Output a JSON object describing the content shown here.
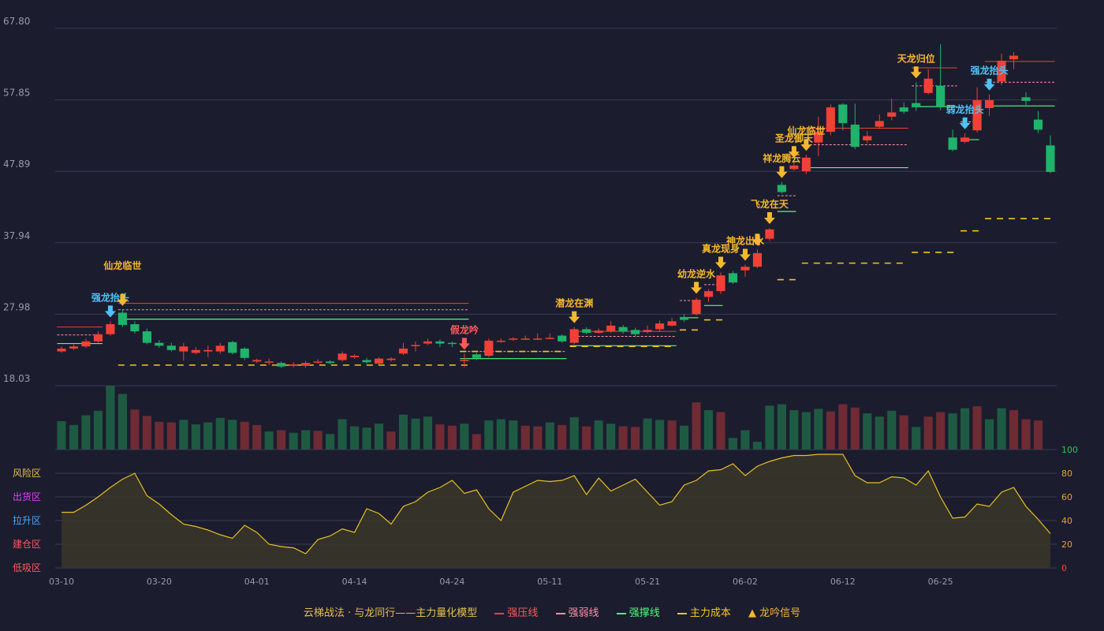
{
  "chart_data": {
    "type": "candlestick",
    "price_axis": {
      "ticks": [
        "67.80",
        "57.85",
        "47.89",
        "37.94",
        "27.98",
        "18.03"
      ],
      "min": 18.03,
      "max": 67.8
    },
    "x_tick_labels": [
      {
        "index": 0,
        "label": "03-10"
      },
      {
        "index": 8,
        "label": "03-20"
      },
      {
        "index": 16,
        "label": "04-01"
      },
      {
        "index": 24,
        "label": "04-14"
      },
      {
        "index": 32,
        "label": "04-24"
      },
      {
        "index": 40,
        "label": "05-11"
      },
      {
        "index": 48,
        "label": "05-21"
      },
      {
        "index": 56,
        "label": "06-02"
      },
      {
        "index": 64,
        "label": "06-12"
      },
      {
        "index": 72,
        "label": "06-25"
      }
    ],
    "candles": [
      [
        22.8,
        23.2,
        23.5,
        22.6
      ],
      [
        23.2,
        23.5,
        23.8,
        23.0
      ],
      [
        23.5,
        24.2,
        24.6,
        23.3
      ],
      [
        24.2,
        25.2,
        25.6,
        24.0
      ],
      [
        25.2,
        26.6,
        27.0,
        25.0
      ],
      [
        28.2,
        26.5,
        28.6,
        26.2
      ],
      [
        26.6,
        25.6,
        27.0,
        25.3
      ],
      [
        25.6,
        24.0,
        26.0,
        23.8
      ],
      [
        24.0,
        23.6,
        24.4,
        23.3
      ],
      [
        23.6,
        23.0,
        24.0,
        22.8
      ],
      [
        22.8,
        23.5,
        24.0,
        21.5
      ],
      [
        22.6,
        23.0,
        23.4,
        22.4
      ],
      [
        22.8,
        23.0,
        23.6,
        22.0
      ],
      [
        22.8,
        23.6,
        24.0,
        22.5
      ],
      [
        24.1,
        22.6,
        24.3,
        22.4
      ],
      [
        23.2,
        21.9,
        23.4,
        21.6
      ],
      [
        21.4,
        21.6,
        21.8,
        21.2
      ],
      [
        21.3,
        21.4,
        21.8,
        20.9
      ],
      [
        21.2,
        20.7,
        21.4,
        20.5
      ],
      [
        20.8,
        21.0,
        21.3,
        20.6
      ],
      [
        20.8,
        21.2,
        21.5,
        20.5
      ],
      [
        21.3,
        21.4,
        21.7,
        21.1
      ],
      [
        21.4,
        21.2,
        21.6,
        21.0
      ],
      [
        21.6,
        22.5,
        22.8,
        21.4
      ],
      [
        22.0,
        22.2,
        22.4,
        21.8
      ],
      [
        21.6,
        21.3,
        21.9,
        21.1
      ],
      [
        21.1,
        21.8,
        22.0,
        21.0
      ],
      [
        21.6,
        21.8,
        22.0,
        21.4
      ],
      [
        22.5,
        23.2,
        24.0,
        22.3
      ],
      [
        23.6,
        23.7,
        24.2,
        22.8
      ],
      [
        23.9,
        24.2,
        24.6,
        23.7
      ],
      [
        24.2,
        23.9,
        24.5,
        23.4
      ],
      [
        24.0,
        23.9,
        24.2,
        23.4
      ],
      [
        21.5,
        21.6,
        22.5,
        20.6
      ],
      [
        22.4,
        21.9,
        22.6,
        21.6
      ],
      [
        22.2,
        24.3,
        24.6,
        22.0
      ],
      [
        24.2,
        24.3,
        24.6,
        24.0
      ],
      [
        24.5,
        24.6,
        24.8,
        24.3
      ],
      [
        24.6,
        24.6,
        25.0,
        24.4
      ],
      [
        24.6,
        24.6,
        25.3,
        24.4
      ],
      [
        24.7,
        24.7,
        25.3,
        24.5
      ],
      [
        25.0,
        24.2,
        25.2,
        24.0
      ],
      [
        24.0,
        25.9,
        26.2,
        23.8
      ],
      [
        25.9,
        25.4,
        26.2,
        25.2
      ],
      [
        25.4,
        25.7,
        26.0,
        25.3
      ],
      [
        25.6,
        26.4,
        27.0,
        25.4
      ],
      [
        26.2,
        25.6,
        26.5,
        25.3
      ],
      [
        25.8,
        25.2,
        26.1,
        24.8
      ],
      [
        25.5,
        25.8,
        26.4,
        25.3
      ],
      [
        25.9,
        26.7,
        27.1,
        25.5
      ],
      [
        26.4,
        27.0,
        27.5,
        26.3
      ],
      [
        27.6,
        27.2,
        28.0,
        26.9
      ],
      [
        28.0,
        30.0,
        30.3,
        27.8
      ],
      [
        30.4,
        31.2,
        31.5,
        29.7
      ],
      [
        31.2,
        33.4,
        33.8,
        30.8
      ],
      [
        33.7,
        32.4,
        34.0,
        32.2
      ],
      [
        34.1,
        34.6,
        34.9,
        33.2
      ],
      [
        34.6,
        36.5,
        37.0,
        34.4
      ],
      [
        38.5,
        39.8,
        40.0,
        38.2
      ],
      [
        46.0,
        45.0,
        46.4,
        44.8
      ],
      [
        48.2,
        48.7,
        49.2,
        48.0
      ],
      [
        47.9,
        49.8,
        50.2,
        47.5
      ],
      [
        51.9,
        53.4,
        55.5,
        50.0
      ],
      [
        53.4,
        56.8,
        57.2,
        52.9
      ],
      [
        57.2,
        54.6,
        57.4,
        53.6
      ],
      [
        54.4,
        51.3,
        57.3,
        51.0
      ],
      [
        52.2,
        52.8,
        53.5,
        51.8
      ],
      [
        54.1,
        54.9,
        55.8,
        53.8
      ],
      [
        55.5,
        56.1,
        58.0,
        55.0
      ],
      [
        56.8,
        56.2,
        57.5,
        55.9
      ],
      [
        57.4,
        56.8,
        60.3,
        56.3
      ],
      [
        58.8,
        60.8,
        62.1,
        58.6
      ],
      [
        59.8,
        56.9,
        65.6,
        56.4
      ],
      [
        52.6,
        50.9,
        53.7,
        50.7
      ],
      [
        52.0,
        52.6,
        53.2,
        51.8
      ],
      [
        53.6,
        57.8,
        59.6,
        53.3
      ],
      [
        56.7,
        57.8,
        58.6,
        55.6
      ],
      [
        60.4,
        63.3,
        64.3,
        59.9
      ],
      [
        63.5,
        64.0,
        64.5,
        62.1
      ],
      [
        58.2,
        57.7,
        58.9,
        56.9
      ],
      [
        55.1,
        53.7,
        56.3,
        53.2
      ],
      [
        51.5,
        47.8,
        52.9,
        47.6
      ]
    ],
    "volume": [
      [
        44,
        1
      ],
      [
        38,
        1
      ],
      [
        53,
        1
      ],
      [
        60,
        1
      ],
      [
        99,
        1
      ],
      [
        86,
        1
      ],
      [
        62,
        0
      ],
      [
        52,
        0
      ],
      [
        43,
        0
      ],
      [
        42,
        0
      ],
      [
        46,
        1
      ],
      [
        39,
        1
      ],
      [
        42,
        1
      ],
      [
        49,
        1
      ],
      [
        46,
        1
      ],
      [
        43,
        0
      ],
      [
        38,
        0
      ],
      [
        28,
        1
      ],
      [
        30,
        0
      ],
      [
        26,
        1
      ],
      [
        30,
        1
      ],
      [
        29,
        0
      ],
      [
        24,
        1
      ],
      [
        47,
        1
      ],
      [
        36,
        1
      ],
      [
        34,
        1
      ],
      [
        40,
        1
      ],
      [
        28,
        0
      ],
      [
        54,
        1
      ],
      [
        48,
        1
      ],
      [
        51,
        1
      ],
      [
        39,
        0
      ],
      [
        37,
        0
      ],
      [
        40,
        1
      ],
      [
        24,
        0
      ],
      [
        45,
        1
      ],
      [
        47,
        1
      ],
      [
        45,
        1
      ],
      [
        37,
        0
      ],
      [
        36,
        0
      ],
      [
        42,
        1
      ],
      [
        38,
        0
      ],
      [
        50,
        1
      ],
      [
        36,
        0
      ],
      [
        45,
        1
      ],
      [
        40,
        1
      ],
      [
        36,
        0
      ],
      [
        35,
        0
      ],
      [
        48,
        1
      ],
      [
        46,
        1
      ],
      [
        45,
        0
      ],
      [
        37,
        1
      ],
      [
        73,
        0
      ],
      [
        61,
        1
      ],
      [
        58,
        0
      ],
      [
        18,
        1
      ],
      [
        30,
        1
      ],
      [
        12,
        1
      ],
      [
        68,
        1
      ],
      [
        70,
        1
      ],
      [
        61,
        1
      ],
      [
        58,
        1
      ],
      [
        63,
        1
      ],
      [
        59,
        0
      ],
      [
        70,
        0
      ],
      [
        65,
        0
      ],
      [
        56,
        1
      ],
      [
        51,
        1
      ],
      [
        60,
        1
      ],
      [
        53,
        0
      ],
      [
        35,
        1
      ],
      [
        51,
        0
      ],
      [
        58,
        0
      ],
      [
        56,
        1
      ],
      [
        64,
        1
      ],
      [
        67,
        0
      ],
      [
        47,
        1
      ],
      [
        64,
        1
      ],
      [
        61,
        0
      ],
      [
        47,
        0
      ],
      [
        45,
        0
      ]
    ],
    "oscillator": [
      47,
      47,
      53,
      60,
      68,
      75,
      80,
      61,
      54,
      45,
      37,
      35,
      32,
      28,
      25,
      36,
      30,
      20,
      18,
      17,
      12,
      24,
      27,
      33,
      30,
      50,
      46,
      37,
      52,
      56,
      64,
      68,
      74,
      63,
      66,
      50,
      40,
      64,
      69,
      74,
      73,
      74,
      78,
      62,
      76,
      65,
      70,
      75,
      64,
      53,
      56,
      70,
      74,
      82,
      83,
      88,
      78,
      86,
      90,
      93,
      95,
      95,
      96,
      96,
      96,
      78,
      72,
      72,
      77,
      76,
      70,
      82,
      60,
      42,
      43,
      54,
      52,
      64,
      68,
      52,
      41,
      29
    ],
    "oscillator_axis": {
      "ticks": [
        "0",
        "20",
        "40",
        "60",
        "80",
        "100"
      ],
      "min": 0,
      "max": 100
    },
    "zone_labels": [
      {
        "label": "风险区",
        "color": "#e8c04a"
      },
      {
        "label": "出货区",
        "color": "#e040fb"
      },
      {
        "label": "拉升区",
        "color": "#4aa8ff"
      },
      {
        "label": "建仓区",
        "color": "#ff5a5a"
      },
      {
        "label": "低吸区",
        "color": "#ff5a5a"
      }
    ],
    "signals": [
      {
        "index": 4,
        "label": "强龙抬头",
        "color": "#4fc3f7",
        "low": true
      },
      {
        "index": 5,
        "label": "仙龙临世",
        "color": "#f5b82e",
        "low": true,
        "stack": 2
      },
      {
        "index": 33,
        "label": "假龙吟",
        "color": "#ff5a5a"
      },
      {
        "index": 42,
        "label": "潜龙在渊",
        "color": "#f5b82e"
      },
      {
        "index": 52,
        "label": "幼龙逆水",
        "color": "#f5b82e"
      },
      {
        "index": 54,
        "label": "真龙现身",
        "color": "#f5b82e"
      },
      {
        "index": 56,
        "label": "神龙出水",
        "color": "#f5b82e"
      },
      {
        "index": 57,
        "label": "神龙出水",
        "color": "#f5b82e",
        "hide_label": true
      },
      {
        "index": 58,
        "label": "飞龙在天",
        "color": "#f5b82e"
      },
      {
        "index": 59,
        "label": "祥龙腾云",
        "color": "#f5b82e"
      },
      {
        "index": 60,
        "label": "圣龙御天",
        "color": "#f5b82e"
      },
      {
        "index": 61,
        "label": "仙龙临世",
        "color": "#f5b82e"
      },
      {
        "index": 70,
        "label": "天龙归位",
        "color": "#f5b82e"
      },
      {
        "index": 74,
        "label": "弱龙抬头",
        "color": "#4fc3f7"
      },
      {
        "index": 76,
        "label": "强龙抬头",
        "color": "#4fc3f7"
      }
    ],
    "levels": [
      {
        "kind": "pressure",
        "from": 0,
        "to": 3,
        "value": 26.2
      },
      {
        "kind": "weak",
        "from": 0,
        "to": 3,
        "value": 25.1
      },
      {
        "kind": "support",
        "from": 0,
        "to": 3,
        "value": 23.9
      },
      {
        "kind": "pressure",
        "from": 5,
        "to": 33,
        "value": 29.5
      },
      {
        "kind": "weak",
        "from": 5,
        "to": 33,
        "value": 28.6
      },
      {
        "kind": "support",
        "from": 5,
        "to": 33,
        "value": 27.3
      },
      {
        "kind": "cost",
        "from": 5,
        "to": 33,
        "value": 20.9
      },
      {
        "kind": "weak",
        "from": 33,
        "to": 41,
        "value": 22.8
      },
      {
        "kind": "cost",
        "from": 33,
        "to": 41,
        "value": 22.8
      },
      {
        "kind": "support",
        "from": 33,
        "to": 41,
        "value": 21.8
      },
      {
        "kind": "pressure",
        "from": 42,
        "to": 50,
        "value": 25.6
      },
      {
        "kind": "weak",
        "from": 42,
        "to": 50,
        "value": 24.9
      },
      {
        "kind": "support",
        "from": 42,
        "to": 50,
        "value": 23.6
      },
      {
        "kind": "cost",
        "from": 42,
        "to": 50,
        "value": 23.5
      },
      {
        "kind": "weak",
        "from": 51,
        "to": 51.8,
        "value": 29.9
      },
      {
        "kind": "support",
        "from": 51,
        "to": 51.8,
        "value": 27.5
      },
      {
        "kind": "cost",
        "from": 51,
        "to": 51.8,
        "value": 25.8
      },
      {
        "kind": "weak",
        "from": 53,
        "to": 53.8,
        "value": 32.1
      },
      {
        "kind": "support",
        "from": 53,
        "to": 53.8,
        "value": 29.2
      },
      {
        "kind": "cost",
        "from": 53,
        "to": 53.8,
        "value": 27.2
      },
      {
        "kind": "weak",
        "from": 59,
        "to": 59.8,
        "value": 44.5
      },
      {
        "kind": "support",
        "from": 59,
        "to": 59.8,
        "value": 42.3
      },
      {
        "kind": "cost",
        "from": 59,
        "to": 59.8,
        "value": 32.8
      },
      {
        "kind": "pressure",
        "from": 61,
        "to": 69,
        "value": 53.9
      },
      {
        "kind": "weak",
        "from": 61,
        "to": 69,
        "value": 51.6
      },
      {
        "kind": "support",
        "from": 61,
        "to": 69,
        "value": 48.4
      },
      {
        "kind": "cost",
        "from": 61,
        "to": 69,
        "value": 35.1
      },
      {
        "kind": "pressure",
        "from": 70,
        "to": 73,
        "value": 62.3
      },
      {
        "kind": "weak",
        "from": 70,
        "to": 73,
        "value": 59.8
      },
      {
        "kind": "support",
        "from": 70,
        "to": 73,
        "value": 56.9
      },
      {
        "kind": "cost",
        "from": 70,
        "to": 73,
        "value": 36.6
      },
      {
        "kind": "weak",
        "from": 74,
        "to": 74.8,
        "value": 54.8
      },
      {
        "kind": "support",
        "from": 74,
        "to": 74.8,
        "value": 52.3
      },
      {
        "kind": "cost",
        "from": 74,
        "to": 74.8,
        "value": 39.6
      },
      {
        "kind": "pressure",
        "from": 76,
        "to": 81,
        "value": 63.2
      },
      {
        "kind": "weak",
        "from": 76,
        "to": 81,
        "value": 60.3
      },
      {
        "kind": "support",
        "from": 76,
        "to": 81,
        "value": 57.0
      },
      {
        "kind": "cost",
        "from": 76,
        "to": 81,
        "value": 41.3
      }
    ],
    "colors": {
      "up": "#ef4136",
      "down": "#1fb36b",
      "vol_up": "#6e2b34",
      "vol_down": "#1e5a42",
      "pressure": "#ef4136",
      "weak": "#ff8fa3",
      "support": "#4cff7a",
      "cost": "#f5c518",
      "osc_line": "#e8c020",
      "osc_fill": "#3a3628",
      "grid": "#3a3b52",
      "axis_text": "#9a9aa8",
      "osc_tick": "#e8a030",
      "osc_tick_top": "#22cc55",
      "osc_tick_bottom": "#ff4040"
    }
  },
  "legend": {
    "title": "云梯战法 · 与龙同行——主力量化模型",
    "pressure": "强压线",
    "weak": "强弱线",
    "support": "强撑线",
    "cost": "主力成本",
    "signal": "龙吟信号",
    "signal_glyph": "▲"
  }
}
